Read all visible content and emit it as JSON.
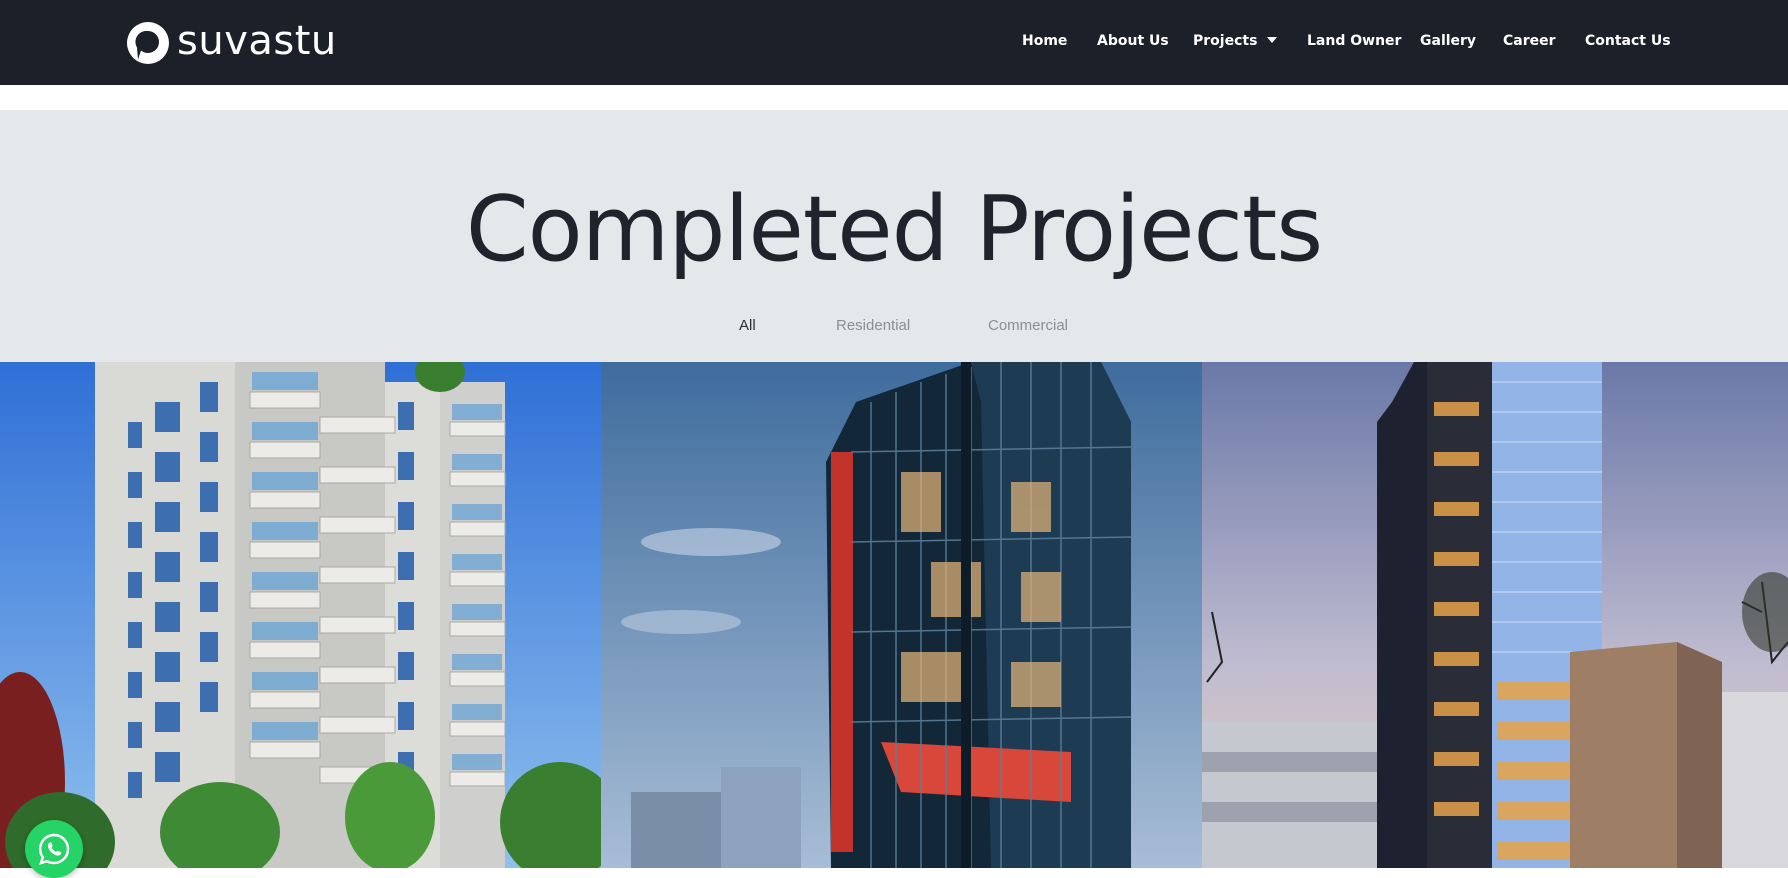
{
  "brand": {
    "name": "suvastu"
  },
  "nav": {
    "items": [
      "Home",
      "About Us",
      "Projects",
      "Land Owner",
      "Gallery",
      "Career",
      "Contact Us"
    ]
  },
  "hero": {
    "title": "Completed Projects",
    "filters": [
      "All",
      "Residential",
      "Commercial"
    ],
    "active_filter": "All"
  },
  "projects": [
    {
      "kind": "residential tower",
      "icon": "building-photo"
    },
    {
      "kind": "glass commercial tower",
      "icon": "building-photo"
    },
    {
      "kind": "high-rise tower at dusk",
      "icon": "building-photo"
    }
  ],
  "floating": {
    "icon": "whatsapp-icon",
    "color": "#25d366"
  },
  "colors": {
    "header_bg": "#1c2028",
    "hero_bg": "#e4e8eb",
    "title": "#1f232b"
  }
}
